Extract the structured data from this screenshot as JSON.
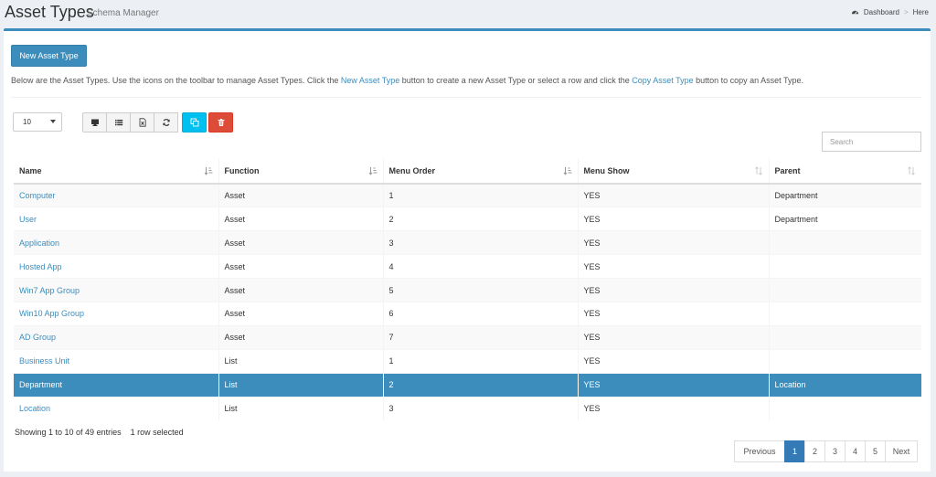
{
  "header": {
    "title": "Asset Types",
    "subtitle": "Schema Manager"
  },
  "breadcrumb": {
    "items": [
      "Dashboard",
      "Here"
    ],
    "separator": ">"
  },
  "toolbar": {
    "new_label": "New Asset Type"
  },
  "intro": {
    "part1": "Below are the Asset Types. Use the icons on the toolbar to manage Asset Types. Click the ",
    "link1": "New Asset Type",
    "part2": " button to create a new Asset Type or select a row and click the ",
    "link2": "Copy Asset Type",
    "part3": " button to copy an Asset Type."
  },
  "page_size": {
    "value": "10"
  },
  "buttons": [
    "monitor-icon",
    "list-icon",
    "excel-icon",
    "refresh-icon",
    "copy-icon",
    "trash-icon"
  ],
  "search": {
    "placeholder": "Search"
  },
  "table": {
    "columns": [
      "Name",
      "Function",
      "Menu Order",
      "Menu Show",
      "Parent"
    ],
    "rows": [
      [
        "Computer",
        "Asset",
        "1",
        "YES",
        "Department"
      ],
      [
        "User",
        "Asset",
        "2",
        "YES",
        "Department"
      ],
      [
        "Application",
        "Asset",
        "3",
        "YES",
        ""
      ],
      [
        "Hosted App",
        "Asset",
        "4",
        "YES",
        ""
      ],
      [
        "Win7 App Group",
        "Asset",
        "5",
        "YES",
        ""
      ],
      [
        "Win10 App Group",
        "Asset",
        "6",
        "YES",
        ""
      ],
      [
        "AD Group",
        "Asset",
        "7",
        "YES",
        ""
      ],
      [
        "Business Unit",
        "List",
        "1",
        "YES",
        ""
      ],
      [
        "Department",
        "List",
        "2",
        "YES",
        "Location"
      ],
      [
        "Location",
        "List",
        "3",
        "YES",
        ""
      ]
    ],
    "selected_row": 8
  },
  "footer": {
    "info": "Showing 1 to 10 of 49 entries",
    "selected": "1 row selected"
  },
  "pagination": {
    "prev": "Previous",
    "pages": [
      "1",
      "2",
      "3",
      "4",
      "5"
    ],
    "active": "1",
    "next": "Next"
  },
  "colors": {
    "primary": "#3c8dbc",
    "info": "#00c0ef",
    "danger": "#dd4b39"
  }
}
